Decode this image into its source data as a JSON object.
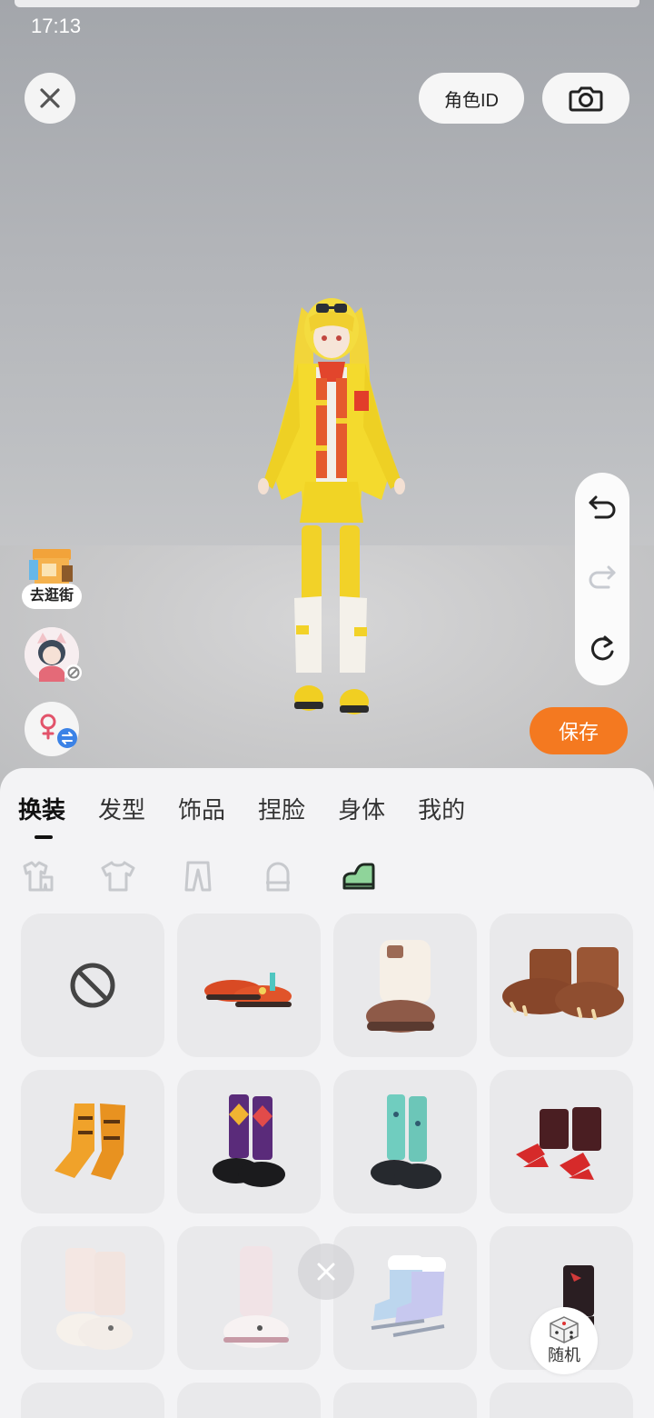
{
  "status": {
    "time": "17:13"
  },
  "top": {
    "role_id_label": "角色ID",
    "close_icon": "close-icon",
    "camera_icon": "camera-icon"
  },
  "left": {
    "shop_label": "去逛街"
  },
  "right": {
    "undo_icon": "undo-icon",
    "redo_icon": "redo-icon",
    "reset_icon": "reset-icon",
    "save_label": "保存"
  },
  "tabs": [
    {
      "label": "换装",
      "active": true
    },
    {
      "label": "发型",
      "active": false
    },
    {
      "label": "饰品",
      "active": false
    },
    {
      "label": "捏脸",
      "active": false
    },
    {
      "label": "身体",
      "active": false
    },
    {
      "label": "我的",
      "active": false
    }
  ],
  "subcategories": [
    "outfit-set",
    "top",
    "bottom",
    "socks",
    "shoes"
  ],
  "subcategory_selected": "shoes",
  "items": [
    "none",
    "red-loafers",
    "white-fur-boots",
    "brown-paw-boots",
    "orange-tiger-boots",
    "argyle-socks-shoes",
    "teal-socks-shoes",
    "red-claw-boots",
    "bunny-slippers-pink",
    "bunny-slippers-white",
    "iridescent-ice-skates",
    "black-red-boots"
  ],
  "bottom": {
    "random_label": "随机"
  }
}
